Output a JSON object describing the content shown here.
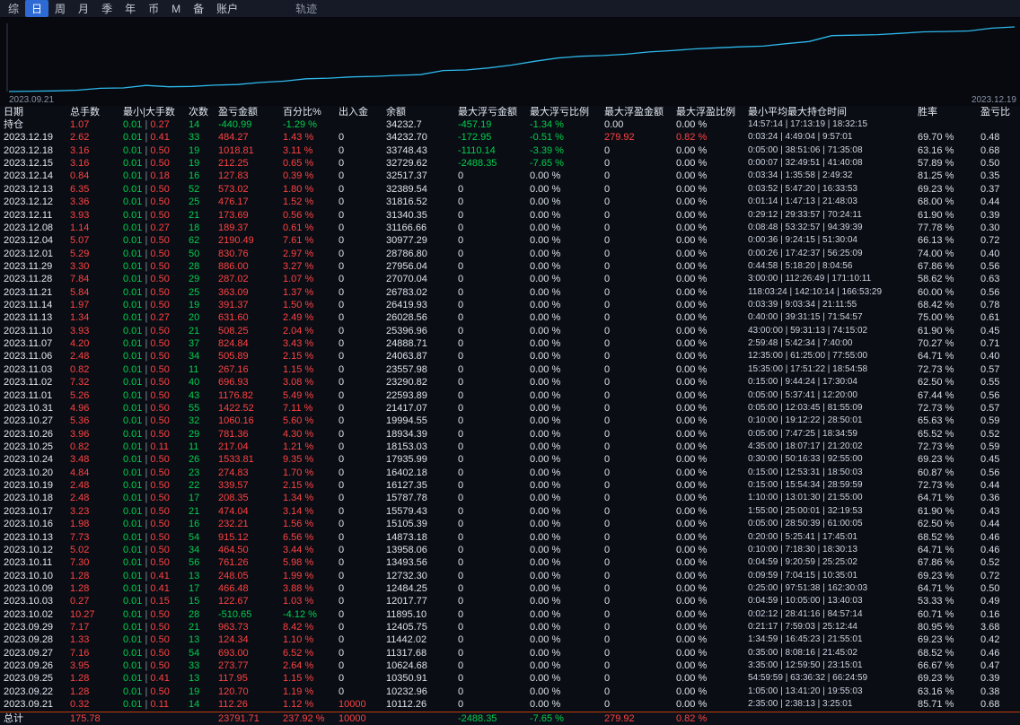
{
  "menu": {
    "items": [
      {
        "label": "综"
      },
      {
        "label": "日",
        "active": true
      },
      {
        "label": "周"
      },
      {
        "label": "月"
      },
      {
        "label": "季"
      },
      {
        "label": "年"
      },
      {
        "label": "币"
      },
      {
        "label": "M"
      },
      {
        "label": "备"
      },
      {
        "label": "账户"
      },
      {
        "label": "轨迹",
        "muted": true,
        "gap": true
      }
    ]
  },
  "chart": {
    "start_label": "2023.09.21",
    "end_label": "2023.12.19"
  },
  "chart_data": {
    "type": "line",
    "title": "",
    "xlabel": "",
    "ylabel": "",
    "legend": false,
    "grid": false,
    "line_color": "#2eb8ea",
    "ylim": [
      10000,
      34500
    ],
    "x": [
      "2023.09.21",
      "2023.09.22",
      "2023.09.25",
      "2023.09.26",
      "2023.09.27",
      "2023.09.28",
      "2023.09.29",
      "2023.10.02",
      "2023.10.03",
      "2023.10.09",
      "2023.10.10",
      "2023.10.11",
      "2023.10.12",
      "2023.10.13",
      "2023.10.16",
      "2023.10.17",
      "2023.10.18",
      "2023.10.19",
      "2023.10.20",
      "2023.10.24",
      "2023.10.25",
      "2023.10.26",
      "2023.10.27",
      "2023.10.31",
      "2023.11.01",
      "2023.11.02",
      "2023.11.03",
      "2023.11.06",
      "2023.11.07",
      "2023.11.10",
      "2023.11.13",
      "2023.11.14",
      "2023.11.21",
      "2023.11.28",
      "2023.11.29",
      "2023.12.01",
      "2023.12.04",
      "2023.12.08",
      "2023.12.11",
      "2023.12.12",
      "2023.12.13",
      "2023.12.14",
      "2023.12.15",
      "2023.12.18",
      "2023.12.19"
    ],
    "values": [
      10112.26,
      10232.96,
      10350.91,
      10624.68,
      11317.68,
      11442.02,
      12405.75,
      11895.1,
      12017.77,
      12484.25,
      12732.3,
      13493.56,
      13958.06,
      14873.18,
      15105.39,
      15579.43,
      15787.78,
      16127.35,
      16402.18,
      17935.99,
      18153.03,
      18934.39,
      19994.55,
      21417.07,
      22593.89,
      23290.82,
      23557.98,
      24063.87,
      24888.71,
      25396.96,
      26028.56,
      26419.93,
      26783.02,
      27070.04,
      27956.04,
      28786.8,
      30977.29,
      31166.66,
      31340.35,
      31816.52,
      32389.54,
      32517.37,
      32729.62,
      33748.43,
      34232.7
    ]
  },
  "colors": {
    "profit": "#ff4242",
    "loss": "#00cf4e",
    "accent": "#2e6ad4",
    "curve": "#2eb8ea",
    "total_divider": "#bf3b0e"
  },
  "table": {
    "headers": [
      "日期",
      "总手数",
      "最小|大手数",
      "次数",
      "盈亏金额",
      "百分比%",
      "出入金",
      "余额",
      "最大浮亏金额",
      "最大浮亏比例",
      "最大浮盈金额",
      "最大浮盈比例",
      "最小平均最大持仓时间",
      "胜率",
      "盈亏比"
    ],
    "columns": [
      "date",
      "lots",
      "min",
      "max",
      "count",
      "pnl",
      "pct",
      "inout",
      "balance",
      "mfl",
      "mflp",
      "mfp",
      "mfpp",
      "time",
      "win",
      "plr"
    ],
    "position_row": [
      "持仓",
      "1.07",
      "0.01",
      "0.27",
      "14",
      "-440.99",
      "-1.29 %",
      "",
      "34232.7",
      "-457.19",
      "-1.34 %",
      "0.00",
      "0.00 %",
      "14:57:14 | 17:13:19 | 18:32:15",
      "",
      ""
    ],
    "rows": [
      [
        "2023.12.19",
        "2.62",
        "0.01",
        "0.41",
        "33",
        "484.27",
        "1.43 %",
        "0",
        "34232.70",
        "-172.95",
        "-0.51 %",
        "279.92",
        "0.82 %",
        "0:03:24 | 4:49:04 | 9:57:01",
        "69.70 %",
        "0.48"
      ],
      [
        "2023.12.18",
        "3.16",
        "0.01",
        "0.50",
        "19",
        "1018.81",
        "3.11 %",
        "0",
        "33748.43",
        "-1110.14",
        "-3.39 %",
        "0",
        "0.00 %",
        "0:05:00 | 38:51:06 | 71:35:08",
        "63.16 %",
        "0.68"
      ],
      [
        "2023.12.15",
        "3.16",
        "0.01",
        "0.50",
        "19",
        "212.25",
        "0.65 %",
        "0",
        "32729.62",
        "-2488.35",
        "-7.65 %",
        "0",
        "0.00 %",
        "0:00:07 | 32:49:51 | 41:40:08",
        "57.89 %",
        "0.50"
      ],
      [
        "2023.12.14",
        "0.84",
        "0.01",
        "0.18",
        "16",
        "127.83",
        "0.39 %",
        "0",
        "32517.37",
        "0",
        "0.00 %",
        "0",
        "0.00 %",
        "0:03:34 | 1:35:58 | 2:49:32",
        "81.25 %",
        "0.35"
      ],
      [
        "2023.12.13",
        "6.35",
        "0.01",
        "0.50",
        "52",
        "573.02",
        "1.80 %",
        "0",
        "32389.54",
        "0",
        "0.00 %",
        "0",
        "0.00 %",
        "0:03:52 | 5:47:20 | 16:33:53",
        "69.23 %",
        "0.37"
      ],
      [
        "2023.12.12",
        "3.36",
        "0.01",
        "0.50",
        "25",
        "476.17",
        "1.52 %",
        "0",
        "31816.52",
        "0",
        "0.00 %",
        "0",
        "0.00 %",
        "0:01:14 | 1:47:13 | 21:48:03",
        "68.00 %",
        "0.44"
      ],
      [
        "2023.12.11",
        "3.93",
        "0.01",
        "0.50",
        "21",
        "173.69",
        "0.56 %",
        "0",
        "31340.35",
        "0",
        "0.00 %",
        "0",
        "0.00 %",
        "0:29:12 | 29:33:57 | 70:24:11",
        "61.90 %",
        "0.39"
      ],
      [
        "2023.12.08",
        "1.14",
        "0.01",
        "0.27",
        "18",
        "189.37",
        "0.61 %",
        "0",
        "31166.66",
        "0",
        "0.00 %",
        "0",
        "0.00 %",
        "0:08:48 | 53:32:57 | 94:39:39",
        "77.78 %",
        "0.30"
      ],
      [
        "2023.12.04",
        "5.07",
        "0.01",
        "0.50",
        "62",
        "2190.49",
        "7.61 %",
        "0",
        "30977.29",
        "0",
        "0.00 %",
        "0",
        "0.00 %",
        "0:00:36 | 9:24:15 | 51:30:04",
        "66.13 %",
        "0.72"
      ],
      [
        "2023.12.01",
        "5.29",
        "0.01",
        "0.50",
        "50",
        "830.76",
        "2.97 %",
        "0",
        "28786.80",
        "0",
        "0.00 %",
        "0",
        "0.00 %",
        "0:00:26 | 17:42:37 | 56:25:09",
        "74.00 %",
        "0.40"
      ],
      [
        "2023.11.29",
        "3.30",
        "0.01",
        "0.50",
        "28",
        "886.00",
        "3.27 %",
        "0",
        "27956.04",
        "0",
        "0.00 %",
        "0",
        "0.00 %",
        "0:44:58 | 5:18:20 | 8:04:56",
        "67.86 %",
        "0.56"
      ],
      [
        "2023.11.28",
        "7.84",
        "0.01",
        "0.50",
        "29",
        "287.02",
        "1.07 %",
        "0",
        "27070.04",
        "0",
        "0.00 %",
        "0",
        "0.00 %",
        "3:00:00 | 112:26:49 | 171:10:11",
        "58.62 %",
        "0.63"
      ],
      [
        "2023.11.21",
        "5.84",
        "0.01",
        "0.50",
        "25",
        "363.09",
        "1.37 %",
        "0",
        "26783.02",
        "0",
        "0.00 %",
        "0",
        "0.00 %",
        "118:03:24 | 142:10:14 | 166:53:29",
        "60.00 %",
        "0.56"
      ],
      [
        "2023.11.14",
        "1.97",
        "0.01",
        "0.50",
        "19",
        "391.37",
        "1.50 %",
        "0",
        "26419.93",
        "0",
        "0.00 %",
        "0",
        "0.00 %",
        "0:03:39 | 9:03:34 | 21:11:55",
        "68.42 %",
        "0.78"
      ],
      [
        "2023.11.13",
        "1.34",
        "0.01",
        "0.27",
        "20",
        "631.60",
        "2.49 %",
        "0",
        "26028.56",
        "0",
        "0.00 %",
        "0",
        "0.00 %",
        "0:40:00 | 39:31:15 | 71:54:57",
        "75.00 %",
        "0.61"
      ],
      [
        "2023.11.10",
        "3.93",
        "0.01",
        "0.50",
        "21",
        "508.25",
        "2.04 %",
        "0",
        "25396.96",
        "0",
        "0.00 %",
        "0",
        "0.00 %",
        "43:00:00 | 59:31:13 | 74:15:02",
        "61.90 %",
        "0.45"
      ],
      [
        "2023.11.07",
        "4.20",
        "0.01",
        "0.50",
        "37",
        "824.84",
        "3.43 %",
        "0",
        "24888.71",
        "0",
        "0.00 %",
        "0",
        "0.00 %",
        "2:59:48 | 5:42:34 | 7:40:00",
        "70.27 %",
        "0.71"
      ],
      [
        "2023.11.06",
        "2.48",
        "0.01",
        "0.50",
        "34",
        "505.89",
        "2.15 %",
        "0",
        "24063.87",
        "0",
        "0.00 %",
        "0",
        "0.00 %",
        "12:35:00 | 61:25:00 | 77:55:00",
        "64.71 %",
        "0.40"
      ],
      [
        "2023.11.03",
        "0.82",
        "0.01",
        "0.50",
        "11",
        "267.16",
        "1.15 %",
        "0",
        "23557.98",
        "0",
        "0.00 %",
        "0",
        "0.00 %",
        "15:35:00 | 17:51:22 | 18:54:58",
        "72.73 %",
        "0.57"
      ],
      [
        "2023.11.02",
        "7.32",
        "0.01",
        "0.50",
        "40",
        "696.93",
        "3.08 %",
        "0",
        "23290.82",
        "0",
        "0.00 %",
        "0",
        "0.00 %",
        "0:15:00 | 9:44:24 | 17:30:04",
        "62.50 %",
        "0.55"
      ],
      [
        "2023.11.01",
        "5.26",
        "0.01",
        "0.50",
        "43",
        "1176.82",
        "5.49 %",
        "0",
        "22593.89",
        "0",
        "0.00 %",
        "0",
        "0.00 %",
        "0:05:00 | 5:37:41 | 12:20:00",
        "67.44 %",
        "0.56"
      ],
      [
        "2023.10.31",
        "4.96",
        "0.01",
        "0.50",
        "55",
        "1422.52",
        "7.11 %",
        "0",
        "21417.07",
        "0",
        "0.00 %",
        "0",
        "0.00 %",
        "0:05:00 | 12:03:45 | 81:55:09",
        "72.73 %",
        "0.57"
      ],
      [
        "2023.10.27",
        "5.36",
        "0.01",
        "0.50",
        "32",
        "1060.16",
        "5.60 %",
        "0",
        "19994.55",
        "0",
        "0.00 %",
        "0",
        "0.00 %",
        "0:10:00 | 19:12:22 | 28:50:01",
        "65.63 %",
        "0.59"
      ],
      [
        "2023.10.26",
        "3.96",
        "0.01",
        "0.50",
        "29",
        "781.36",
        "4.30 %",
        "0",
        "18934.39",
        "0",
        "0.00 %",
        "0",
        "0.00 %",
        "0:05:00 | 7:47:25 | 18:34:59",
        "65.52 %",
        "0.52"
      ],
      [
        "2023.10.25",
        "0.82",
        "0.01",
        "0.11",
        "11",
        "217.04",
        "1.21 %",
        "0",
        "18153.03",
        "0",
        "0.00 %",
        "0",
        "0.00 %",
        "4:35:00 | 18:07:17 | 21:20:02",
        "72.73 %",
        "0.59"
      ],
      [
        "2023.10.24",
        "3.48",
        "0.01",
        "0.50",
        "26",
        "1533.81",
        "9.35 %",
        "0",
        "17935.99",
        "0",
        "0.00 %",
        "0",
        "0.00 %",
        "0:30:00 | 50:16:33 | 92:55:00",
        "69.23 %",
        "0.45"
      ],
      [
        "2023.10.20",
        "4.84",
        "0.01",
        "0.50",
        "23",
        "274.83",
        "1.70 %",
        "0",
        "16402.18",
        "0",
        "0.00 %",
        "0",
        "0.00 %",
        "0:15:00 | 12:53:31 | 18:50:03",
        "60.87 %",
        "0.56"
      ],
      [
        "2023.10.19",
        "2.48",
        "0.01",
        "0.50",
        "22",
        "339.57",
        "2.15 %",
        "0",
        "16127.35",
        "0",
        "0.00 %",
        "0",
        "0.00 %",
        "0:15:00 | 15:54:34 | 28:59:59",
        "72.73 %",
        "0.44"
      ],
      [
        "2023.10.18",
        "2.48",
        "0.01",
        "0.50",
        "17",
        "208.35",
        "1.34 %",
        "0",
        "15787.78",
        "0",
        "0.00 %",
        "0",
        "0.00 %",
        "1:10:00 | 13:01:30 | 21:55:00",
        "64.71 %",
        "0.36"
      ],
      [
        "2023.10.17",
        "3.23",
        "0.01",
        "0.50",
        "21",
        "474.04",
        "3.14 %",
        "0",
        "15579.43",
        "0",
        "0.00 %",
        "0",
        "0.00 %",
        "1:55:00 | 25:00:01 | 32:19:53",
        "61.90 %",
        "0.43"
      ],
      [
        "2023.10.16",
        "1.98",
        "0.01",
        "0.50",
        "16",
        "232.21",
        "1.56 %",
        "0",
        "15105.39",
        "0",
        "0.00 %",
        "0",
        "0.00 %",
        "0:05:00 | 28:50:39 | 61:00:05",
        "62.50 %",
        "0.44"
      ],
      [
        "2023.10.13",
        "7.73",
        "0.01",
        "0.50",
        "54",
        "915.12",
        "6.56 %",
        "0",
        "14873.18",
        "0",
        "0.00 %",
        "0",
        "0.00 %",
        "0:20:00 | 5:25:41 | 17:45:01",
        "68.52 %",
        "0.46"
      ],
      [
        "2023.10.12",
        "5.02",
        "0.01",
        "0.50",
        "34",
        "464.50",
        "3.44 %",
        "0",
        "13958.06",
        "0",
        "0.00 %",
        "0",
        "0.00 %",
        "0:10:00 | 7:18:30 | 18:30:13",
        "64.71 %",
        "0.46"
      ],
      [
        "2023.10.11",
        "7.30",
        "0.01",
        "0.50",
        "56",
        "761.26",
        "5.98 %",
        "0",
        "13493.56",
        "0",
        "0.00 %",
        "0",
        "0.00 %",
        "0:04:59 | 9:20:59 | 25:25:02",
        "67.86 %",
        "0.52"
      ],
      [
        "2023.10.10",
        "1.28",
        "0.01",
        "0.41",
        "13",
        "248.05",
        "1.99 %",
        "0",
        "12732.30",
        "0",
        "0.00 %",
        "0",
        "0.00 %",
        "0:09:59 | 7:04:15 | 10:35:01",
        "69.23 %",
        "0.72"
      ],
      [
        "2023.10.09",
        "1.28",
        "0.01",
        "0.41",
        "17",
        "466.48",
        "3.88 %",
        "0",
        "12484.25",
        "0",
        "0.00 %",
        "0",
        "0.00 %",
        "0:25:00 | 97:51:38 | 162:30:03",
        "64.71 %",
        "0.50"
      ],
      [
        "2023.10.03",
        "0.27",
        "0.01",
        "0.15",
        "15",
        "122.67",
        "1.03 %",
        "0",
        "12017.77",
        "0",
        "0.00 %",
        "0",
        "0.00 %",
        "0:04:59 | 10:05:00 | 13:40:03",
        "53.33 %",
        "0.49"
      ],
      [
        "2023.10.02",
        "10.27",
        "0.01",
        "0.50",
        "28",
        "-510.65",
        "-4.12 %",
        "0",
        "11895.10",
        "0",
        "0.00 %",
        "0",
        "0.00 %",
        "0:02:12 | 28:41:16 | 84:57:14",
        "60.71 %",
        "0.16"
      ],
      [
        "2023.09.29",
        "7.17",
        "0.01",
        "0.50",
        "21",
        "963.73",
        "8.42 %",
        "0",
        "12405.75",
        "0",
        "0.00 %",
        "0",
        "0.00 %",
        "0:21:17 | 7:59:03 | 25:12:44",
        "80.95 %",
        "3.68"
      ],
      [
        "2023.09.28",
        "1.33",
        "0.01",
        "0.50",
        "13",
        "124.34",
        "1.10 %",
        "0",
        "11442.02",
        "0",
        "0.00 %",
        "0",
        "0.00 %",
        "1:34:59 | 16:45:23 | 21:55:01",
        "69.23 %",
        "0.42"
      ],
      [
        "2023.09.27",
        "7.16",
        "0.01",
        "0.50",
        "54",
        "693.00",
        "6.52 %",
        "0",
        "11317.68",
        "0",
        "0.00 %",
        "0",
        "0.00 %",
        "0:35:00 | 8:08:16 | 21:45:02",
        "68.52 %",
        "0.46"
      ],
      [
        "2023.09.26",
        "3.95",
        "0.01",
        "0.50",
        "33",
        "273.77",
        "2.64 %",
        "0",
        "10624.68",
        "0",
        "0.00 %",
        "0",
        "0.00 %",
        "3:35:00 | 12:59:50 | 23:15:01",
        "66.67 %",
        "0.47"
      ],
      [
        "2023.09.25",
        "1.28",
        "0.01",
        "0.41",
        "13",
        "117.95",
        "1.15 %",
        "0",
        "10350.91",
        "0",
        "0.00 %",
        "0",
        "0.00 %",
        "54:59:59 | 63:36:32 | 66:24:59",
        "69.23 %",
        "0.39"
      ],
      [
        "2023.09.22",
        "1.28",
        "0.01",
        "0.50",
        "19",
        "120.70",
        "1.19 %",
        "0",
        "10232.96",
        "0",
        "0.00 %",
        "0",
        "0.00 %",
        "1:05:00 | 13:41:20 | 19:55:03",
        "63.16 %",
        "0.38"
      ],
      [
        "2023.09.21",
        "0.32",
        "0.01",
        "0.11",
        "14",
        "112.26",
        "1.12 %",
        "10000",
        "10112.26",
        "0",
        "0.00 %",
        "0",
        "0.00 %",
        "2:35:00 | 2:38:13 | 3:25:01",
        "85.71 %",
        "0.68"
      ]
    ],
    "total_row": [
      "总计",
      "175.78",
      "",
      "",
      "",
      "23791.71",
      "237.92 %",
      "10000",
      "",
      "-2488.35",
      "-7.65 %",
      "279.92",
      "0.82 %",
      "",
      "",
      ""
    ]
  }
}
